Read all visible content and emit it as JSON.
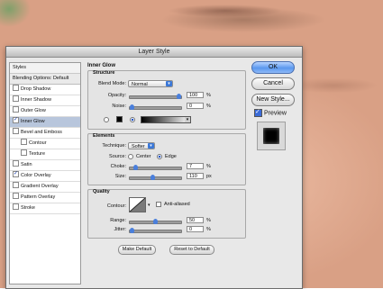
{
  "window": {
    "title": "Layer Style"
  },
  "styles_list": {
    "header": "Styles",
    "blending": "Blending Options: Default",
    "items": [
      {
        "label": "Drop Shadow",
        "checked": false
      },
      {
        "label": "Inner Shadow",
        "checked": false
      },
      {
        "label": "Outer Glow",
        "checked": false
      },
      {
        "label": "Inner Glow",
        "checked": true,
        "selected": true
      },
      {
        "label": "Bevel and Emboss",
        "checked": false
      },
      {
        "label": "Contour",
        "checked": false,
        "indent": true
      },
      {
        "label": "Texture",
        "checked": false,
        "indent": true
      },
      {
        "label": "Satin",
        "checked": false
      },
      {
        "label": "Color Overlay",
        "checked": true
      },
      {
        "label": "Gradient Overlay",
        "checked": false
      },
      {
        "label": "Pattern Overlay",
        "checked": false
      },
      {
        "label": "Stroke",
        "checked": false
      }
    ]
  },
  "panel": {
    "title": "Inner Glow",
    "structure": {
      "title": "Structure",
      "blend_mode_label": "Blend Mode:",
      "blend_mode_value": "Normal",
      "opacity_label": "Opacity:",
      "opacity_value": "100",
      "opacity_unit": "%",
      "opacity_level": 1.0,
      "noise_label": "Noise:",
      "noise_value": "0",
      "noise_unit": "%",
      "noise_level": 0,
      "color_swatch": "#000000"
    },
    "elements": {
      "title": "Elements",
      "technique_label": "Technique:",
      "technique_value": "Softer",
      "source_label": "Source:",
      "source_center": "Center",
      "source_edge": "Edge",
      "choke_label": "Choke:",
      "choke_value": "7",
      "choke_unit": "%",
      "choke_level": 0.07,
      "size_label": "Size:",
      "size_value": "110",
      "size_unit": "px",
      "size_level": 0.44
    },
    "quality": {
      "title": "Quality",
      "contour_label": "Contour:",
      "anti_aliased_label": "Anti-aliased",
      "range_label": "Range:",
      "range_value": "50",
      "range_unit": "%",
      "range_level": 0.5,
      "jitter_label": "Jitter:",
      "jitter_value": "0",
      "jitter_unit": "%",
      "jitter_level": 0
    },
    "make_default": "Make Default",
    "reset_default": "Reset to Default"
  },
  "buttons": {
    "ok": "OK",
    "cancel": "Cancel",
    "new_style": "New Style...",
    "preview": "Preview"
  },
  "colors": {
    "accent": "#4a7fdc",
    "ok_button": "#5a98ee",
    "selected_row": "#b8c6dc"
  }
}
